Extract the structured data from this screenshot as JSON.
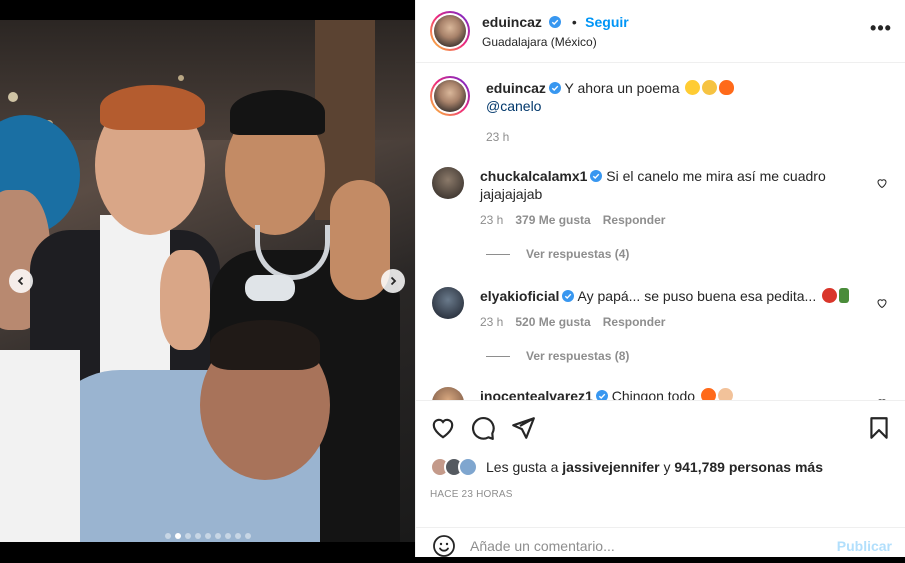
{
  "post": {
    "author": "eduincaz",
    "follow_label": "Seguir",
    "separator": "•",
    "location": "Guadalajara (México)",
    "more_label": "•••",
    "caption_text": "Y ahora un poema",
    "caption_mention": "@canelo",
    "caption_time": "23 h"
  },
  "comments": [
    {
      "user": "chuckalcalamx1",
      "text": "Si el canelo me mira así me cuadro jajajajajab",
      "time": "23 h",
      "likes": "379 Me gusta",
      "reply": "Responder",
      "replies": "Ver respuestas (4)"
    },
    {
      "user": "elyakioficial",
      "text": "Ay papá... se puso buena esa pedita...",
      "time": "23 h",
      "likes": "520 Me gusta",
      "reply": "Responder",
      "replies": "Ver respuestas (8)"
    },
    {
      "user": "inocentealvarez1",
      "text": "Chingon todo"
    }
  ],
  "likes": {
    "prefix": "Les gusta a",
    "user": "jassivejennifer",
    "middle": "y",
    "count": "941,789 personas más"
  },
  "timestamp": "HACE 23 HORAS",
  "add_comment": {
    "placeholder": "Añade un comentario...",
    "publish_label": "Publicar"
  },
  "carousel": {
    "total": 9,
    "current": 2
  },
  "colors": {
    "accent": "#0095f6",
    "verified": "#3897f0",
    "muted": "#8e8e8e"
  }
}
